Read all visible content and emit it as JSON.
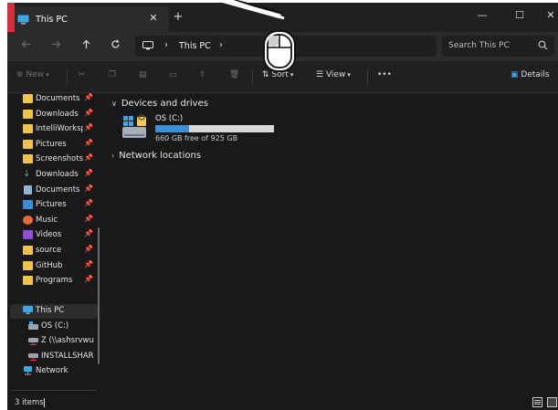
{
  "window": {
    "tab_title": "This PC",
    "new_tab_symbol": "+",
    "close_tab_symbol": "✕",
    "controls": {
      "minimize": "—",
      "maximize": "☐",
      "close": "✕"
    }
  },
  "navigation": {
    "back_icon": "arrow-left-icon",
    "forward_icon": "arrow-right-icon",
    "up_icon": "arrow-up-icon",
    "refresh_icon": "refresh-icon",
    "breadcrumb": [
      "This PC"
    ],
    "search_placeholder": "Search This PC"
  },
  "commandbar": {
    "new_label": "New",
    "sort_label": "Sort",
    "view_label": "View",
    "more_label": "•••",
    "details_label": "Details"
  },
  "sidebar": {
    "quick_access": [
      {
        "label": "Documents",
        "icon": "folder-icon",
        "pinned": true
      },
      {
        "label": "Downloads",
        "icon": "folder-icon",
        "pinned": true
      },
      {
        "label": "IntelliWorkspa",
        "icon": "folder-icon",
        "pinned": true
      },
      {
        "label": "Pictures",
        "icon": "folder-icon",
        "pinned": true
      },
      {
        "label": "Screenshots",
        "icon": "folder-icon",
        "pinned": true
      },
      {
        "label": "Downloads",
        "icon": "download-icon",
        "pinned": true
      },
      {
        "label": "Documents",
        "icon": "document-icon",
        "pinned": true
      },
      {
        "label": "Pictures",
        "icon": "picture-icon",
        "pinned": true
      },
      {
        "label": "Music",
        "icon": "music-icon",
        "pinned": true
      },
      {
        "label": "Videos",
        "icon": "video-icon",
        "pinned": true
      },
      {
        "label": "source",
        "icon": "folder-icon",
        "pinned": true
      },
      {
        "label": "GitHub",
        "icon": "folder-icon",
        "pinned": true
      },
      {
        "label": "Programs",
        "icon": "folder-icon",
        "pinned": true
      }
    ],
    "this_pc": "This PC",
    "drives": [
      "OS (C:)",
      "Z (\\\\ashsrvwum",
      "INSTALLSHARE"
    ],
    "network": "Network"
  },
  "content": {
    "devices_header": "Devices and drives",
    "drive": {
      "name": "OS (C:)",
      "free_text": "660 GB free of 925 GB",
      "used_fraction": 0.287
    },
    "network_header": "Network locations"
  },
  "status": {
    "items_count": "3 items"
  },
  "colors": {
    "accent": "#3b8fd6",
    "folder": "#f0c34a",
    "window_bg": "#191919",
    "brand_strip": "#d6303a"
  }
}
